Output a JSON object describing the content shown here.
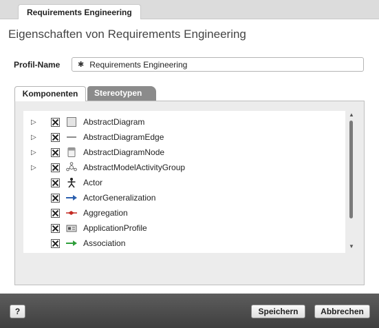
{
  "document_tab": {
    "label": "Requirements Engineering"
  },
  "page": {
    "title": "Eigenschaften von Requirements Engineering"
  },
  "profile": {
    "label": "Profil-Name",
    "value": "Requirements Engineering",
    "marker": "✱"
  },
  "tabs": [
    {
      "label": "Komponenten",
      "active": true
    },
    {
      "label": "Stereotypen",
      "active": false
    }
  ],
  "stereotypes": [
    {
      "label": "AbstractDiagram",
      "expandable": true,
      "checked": true,
      "icon": "diagram-icon"
    },
    {
      "label": "AbstractDiagramEdge",
      "expandable": true,
      "checked": true,
      "icon": "edge-line-icon"
    },
    {
      "label": "AbstractDiagramNode",
      "expandable": true,
      "checked": true,
      "icon": "node-icon"
    },
    {
      "label": "AbstractModelActivityGroup",
      "expandable": true,
      "checked": true,
      "icon": "activity-group-icon"
    },
    {
      "label": "Actor",
      "expandable": false,
      "checked": true,
      "icon": "actor-icon"
    },
    {
      "label": "ActorGeneralization",
      "expandable": false,
      "checked": true,
      "icon": "generalization-arrow-icon"
    },
    {
      "label": "Aggregation",
      "expandable": false,
      "checked": true,
      "icon": "aggregation-icon"
    },
    {
      "label": "ApplicationProfile",
      "expandable": false,
      "checked": true,
      "icon": "application-profile-icon"
    },
    {
      "label": "Association",
      "expandable": false,
      "checked": true,
      "icon": "association-arrow-icon"
    }
  ],
  "footer": {
    "help_label": "?",
    "save_label": "Speichern",
    "cancel_label": "Abbrechen"
  },
  "colors": {
    "footer_bg": "#4a4a4a",
    "inactive_tab_bg": "#8b8b8b",
    "generalization_arrow": "#2b5fae",
    "aggregation_arrow": "#c42a22",
    "association_arrow": "#2e9e3a"
  }
}
